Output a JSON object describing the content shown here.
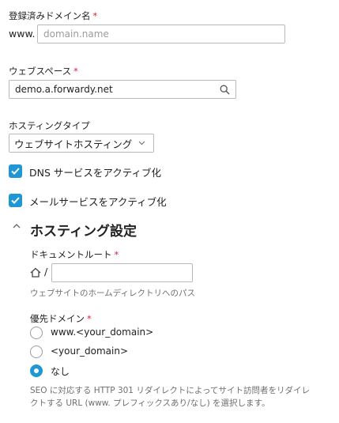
{
  "domain": {
    "label": "登録済みドメイン名",
    "required_mark": "*",
    "prefix": "www.",
    "placeholder": "domain.name",
    "value": ""
  },
  "webspace": {
    "label": "ウェブスペース",
    "required_mark": "*",
    "value": "demo.a.forwardy.net",
    "icon": "search-icon"
  },
  "hosting_type": {
    "label": "ホスティングタイプ",
    "selected": "ウェブサイトホスティング"
  },
  "checkboxes": {
    "dns": {
      "label": "DNS サービスをアクティブ化",
      "checked": true
    },
    "mail": {
      "label": "メールサービスをアクティブ化",
      "checked": true
    }
  },
  "hosting_settings": {
    "title": "ホスティング設定",
    "document_root": {
      "label": "ドキュメントルート",
      "required_mark": "*",
      "prefix": "/",
      "value": "",
      "hint": "ウェブサイトのホームディレクトリへのパス"
    },
    "preferred_domain": {
      "label": "優先ドメイン",
      "required_mark": "*",
      "options": [
        "www.<your_domain>",
        "<your_domain>",
        "なし"
      ],
      "selected_index": 2,
      "hint_line1": "SEO に対応する HTTP 301 リダイレクトによってサイト訪問者をリダイレ",
      "hint_line2": "クトする URL (www. プレフィックスあり/なし) を選択します。"
    }
  },
  "colors": {
    "accent": "#1f97d4",
    "required": "#d7263d",
    "hint": "#6f6f6f",
    "border": "#b9b9b9"
  }
}
